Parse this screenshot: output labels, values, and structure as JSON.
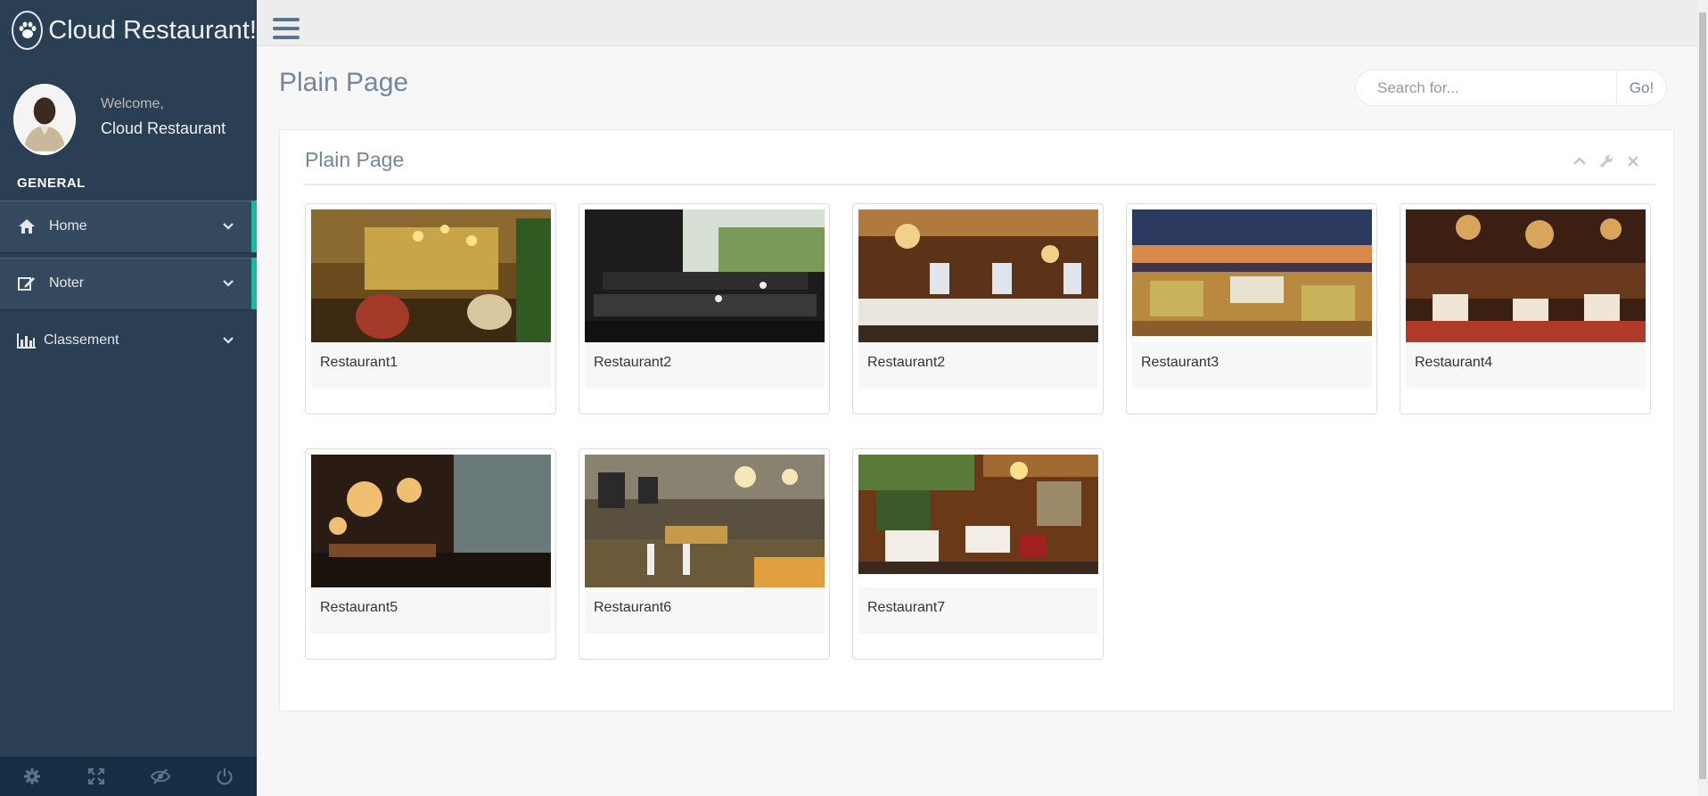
{
  "brand": {
    "title": "Cloud Restaurant!",
    "icon": "paw-icon"
  },
  "profile": {
    "welcome": "Welcome,",
    "name": "Cloud Restaurant"
  },
  "sidebar": {
    "section": "GENERAL",
    "items": [
      {
        "label": "Home",
        "icon": "home-icon"
      },
      {
        "label": "Noter",
        "icon": "edit-icon"
      },
      {
        "label": "Classement",
        "icon": "bar-chart-icon"
      }
    ],
    "footer_icons": [
      "settings-icon",
      "fullscreen-icon",
      "eye-slash-icon",
      "power-icon"
    ]
  },
  "page": {
    "title": "Plain Page"
  },
  "search": {
    "placeholder": "Search for...",
    "button": "Go!"
  },
  "panel": {
    "title": "Plain Page",
    "tools": [
      "chevron-up-icon",
      "wrench-icon",
      "close-icon"
    ]
  },
  "restaurants": [
    {
      "name": "Restaurant1"
    },
    {
      "name": "Restaurant2"
    },
    {
      "name": "Restaurant2"
    },
    {
      "name": "Restaurant3"
    },
    {
      "name": "Restaurant4"
    },
    {
      "name": "Restaurant5"
    },
    {
      "name": "Restaurant6"
    },
    {
      "name": "Restaurant7"
    }
  ],
  "colors": {
    "sidebar": "#2a3f54",
    "accent": "#1abb9c",
    "text": "#73879c"
  }
}
